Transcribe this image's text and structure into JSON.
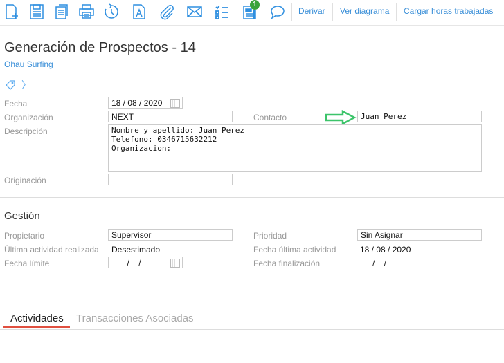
{
  "toolbar": {
    "icons": [
      "new-document-icon",
      "save-icon",
      "copy-icon",
      "print-icon",
      "history-icon",
      "document-a-icon",
      "attach-icon",
      "mail-icon",
      "checklist-icon",
      "notes-icon",
      "comment-icon"
    ],
    "badge": "1",
    "links": [
      "Derivar",
      "Ver diagrama",
      "Cargar horas trabajadas"
    ]
  },
  "header": {
    "title": "Generación de Prospectos - 14",
    "subtitle": "Ohau Surfing"
  },
  "form": {
    "fecha_label": "Fecha",
    "fecha": "18 / 08 / 2020",
    "organizacion_label": "Organización",
    "organizacion": "NEXT",
    "contacto_label": "Contacto",
    "contacto": "Juan Perez",
    "descripcion_label": "Descripción",
    "descripcion": "Nombre y apellido: Juan Perez\nTelefono: 0346715632212\nOrganizacion:",
    "originacion_label": "Originación",
    "originacion": ""
  },
  "gestion": {
    "title": "Gestión",
    "propietario_label": "Propietario",
    "propietario": "Supervisor",
    "prioridad_label": "Prioridad",
    "prioridad": "Sin Asignar",
    "ultima_label": "Última actividad realizada",
    "ultima": "Desestimado",
    "fecha_ultima_label": "Fecha última actividad",
    "fecha_ultima": "18 / 08 / 2020",
    "fecha_limite_label": "Fecha límite",
    "fecha_limite": "  /    /",
    "fecha_fin_label": "Fecha finalización",
    "fecha_fin": "/    /"
  },
  "tabs": [
    {
      "label": "Actividades",
      "active": true
    },
    {
      "label": "Transacciones Asociadas",
      "active": false
    }
  ],
  "colors": {
    "accent": "#2f8fe0",
    "tab_active": "#e05040",
    "arrow": "#3cc46a",
    "badge": "#3aa33a"
  }
}
